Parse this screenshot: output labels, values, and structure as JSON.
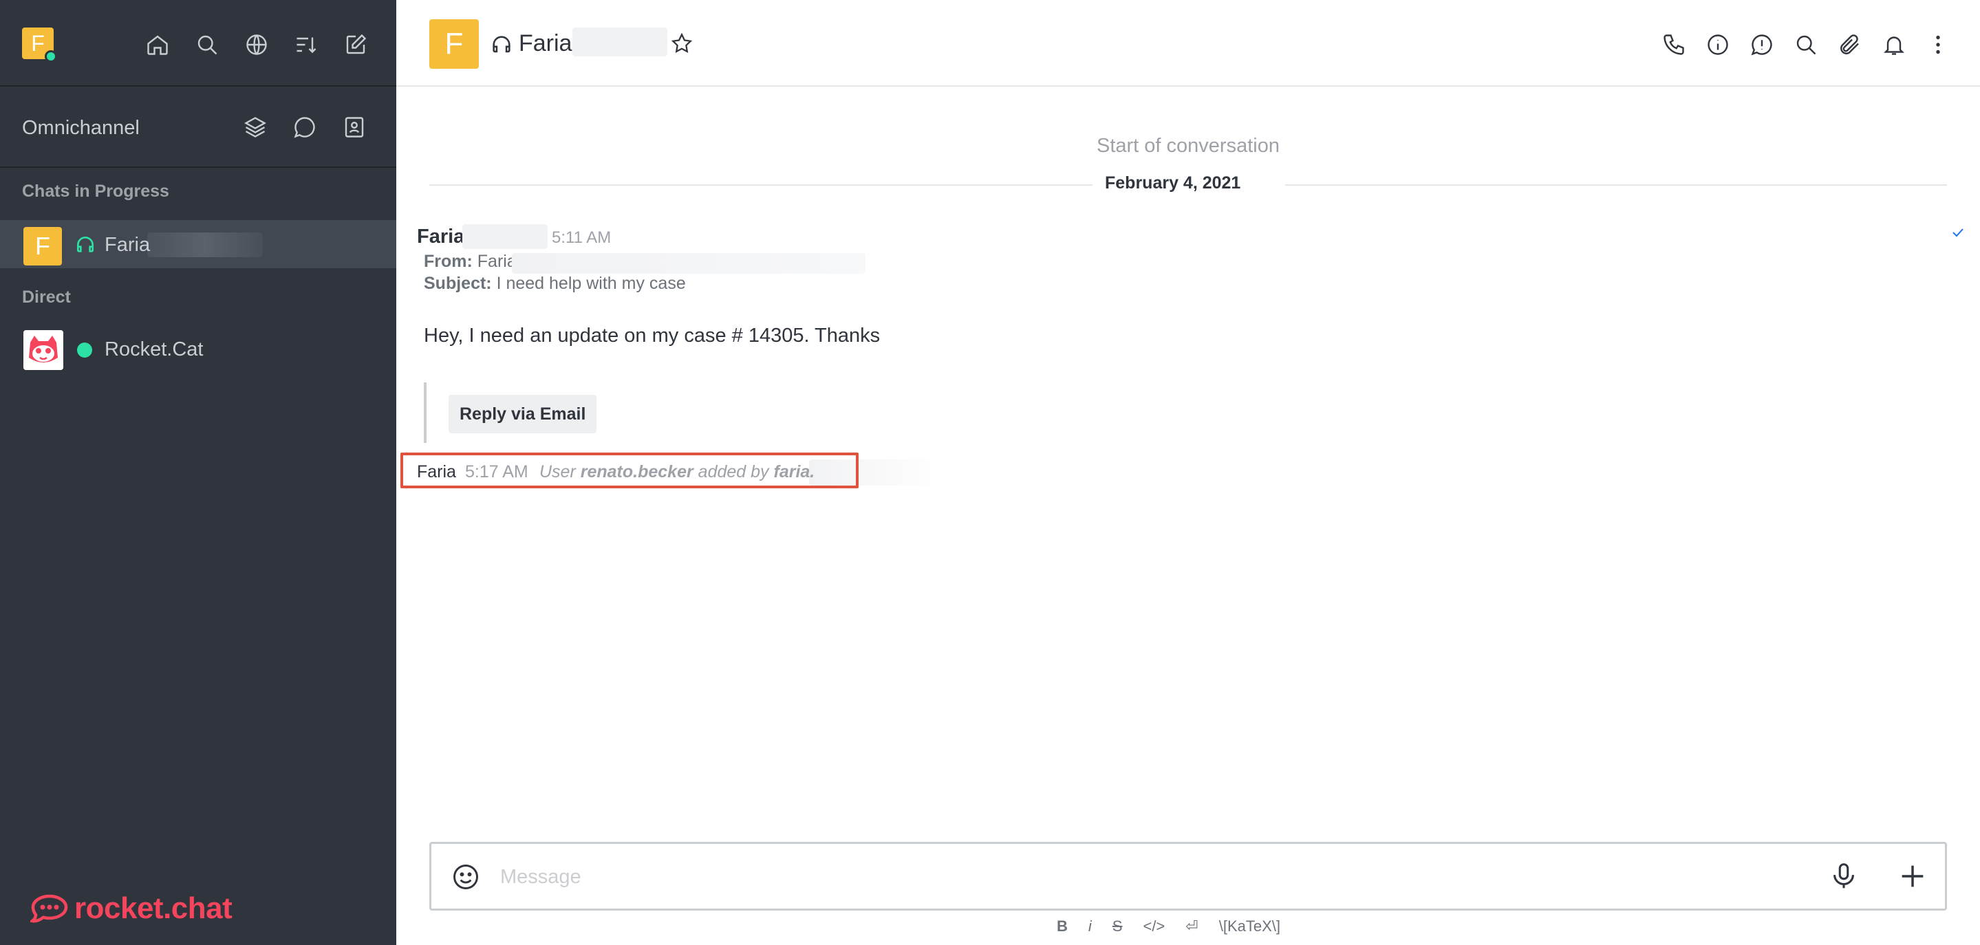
{
  "sidebar": {
    "user_initial": "F",
    "omnichannel_label": "Omnichannel",
    "section_chats_in_progress": "Chats in Progress",
    "section_direct": "Direct",
    "chats": [
      {
        "initial": "F",
        "name": "Faria"
      }
    ],
    "direct": [
      {
        "name": "Rocket.Cat"
      }
    ],
    "brand_text": "rocket.chat"
  },
  "header": {
    "room_initial": "F",
    "room_title": "Faria"
  },
  "conversation": {
    "start_label": "Start of conversation",
    "date_divider": "February 4, 2021",
    "message": {
      "author": "Faria",
      "time": "5:11 AM",
      "from_label": "From:",
      "from_value": "Faria",
      "subject_label": "Subject:",
      "subject_value": "I need help with my case",
      "body": "Hey, I need an update on my case # 14305. Thanks",
      "reply_button": "Reply via Email"
    },
    "system_message": {
      "author": "Faria",
      "time": "5:17 AM",
      "prefix": "User",
      "user": "renato.becker",
      "middle": "added by",
      "actor": "faria."
    }
  },
  "composer": {
    "placeholder": "Message",
    "format": {
      "bold": "B",
      "italic": "i",
      "strike": "S",
      "code": "</>",
      "newline": "⏎",
      "katex": "\\[KaTeX\\]"
    }
  },
  "colors": {
    "sidebar_bg": "#2f343d",
    "avatar_yellow": "#f5bd3a",
    "online_green": "#2de0a5",
    "brand_red": "#f5455c",
    "highlight_red": "#e0533f"
  }
}
